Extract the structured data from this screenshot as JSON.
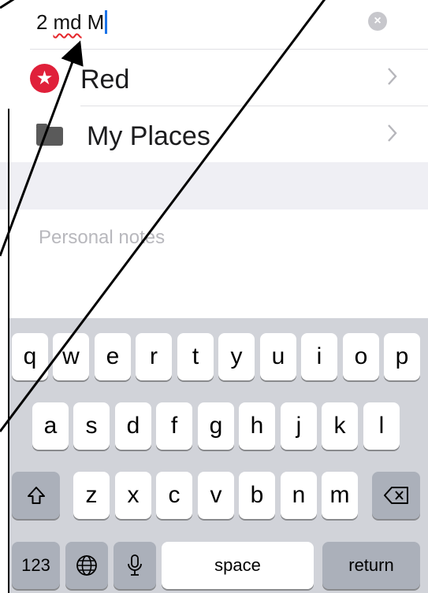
{
  "search": {
    "text_parts": [
      "2",
      "md",
      "M"
    ],
    "clear_icon": "x-circle-icon"
  },
  "list": {
    "items": [
      {
        "label": "Red",
        "icon": "red-star-icon",
        "color": "#e0203a"
      },
      {
        "label": "My Places",
        "icon": "folder-icon",
        "color": "#5a5a5a"
      }
    ]
  },
  "notes": {
    "placeholder": "Personal notes"
  },
  "keyboard": {
    "row1": [
      "q",
      "w",
      "e",
      "r",
      "t",
      "y",
      "u",
      "i",
      "o",
      "p"
    ],
    "row2": [
      "a",
      "s",
      "d",
      "f",
      "g",
      "h",
      "j",
      "k",
      "l"
    ],
    "row3": [
      "z",
      "x",
      "c",
      "v",
      "b",
      "n",
      "m"
    ],
    "numbers_label": "123",
    "space_label": "space",
    "return_label": "return"
  },
  "colors": {
    "accent": "#1a73e8",
    "keyboard_bg": "#d1d3d9",
    "group_bg": "#efeff4"
  }
}
